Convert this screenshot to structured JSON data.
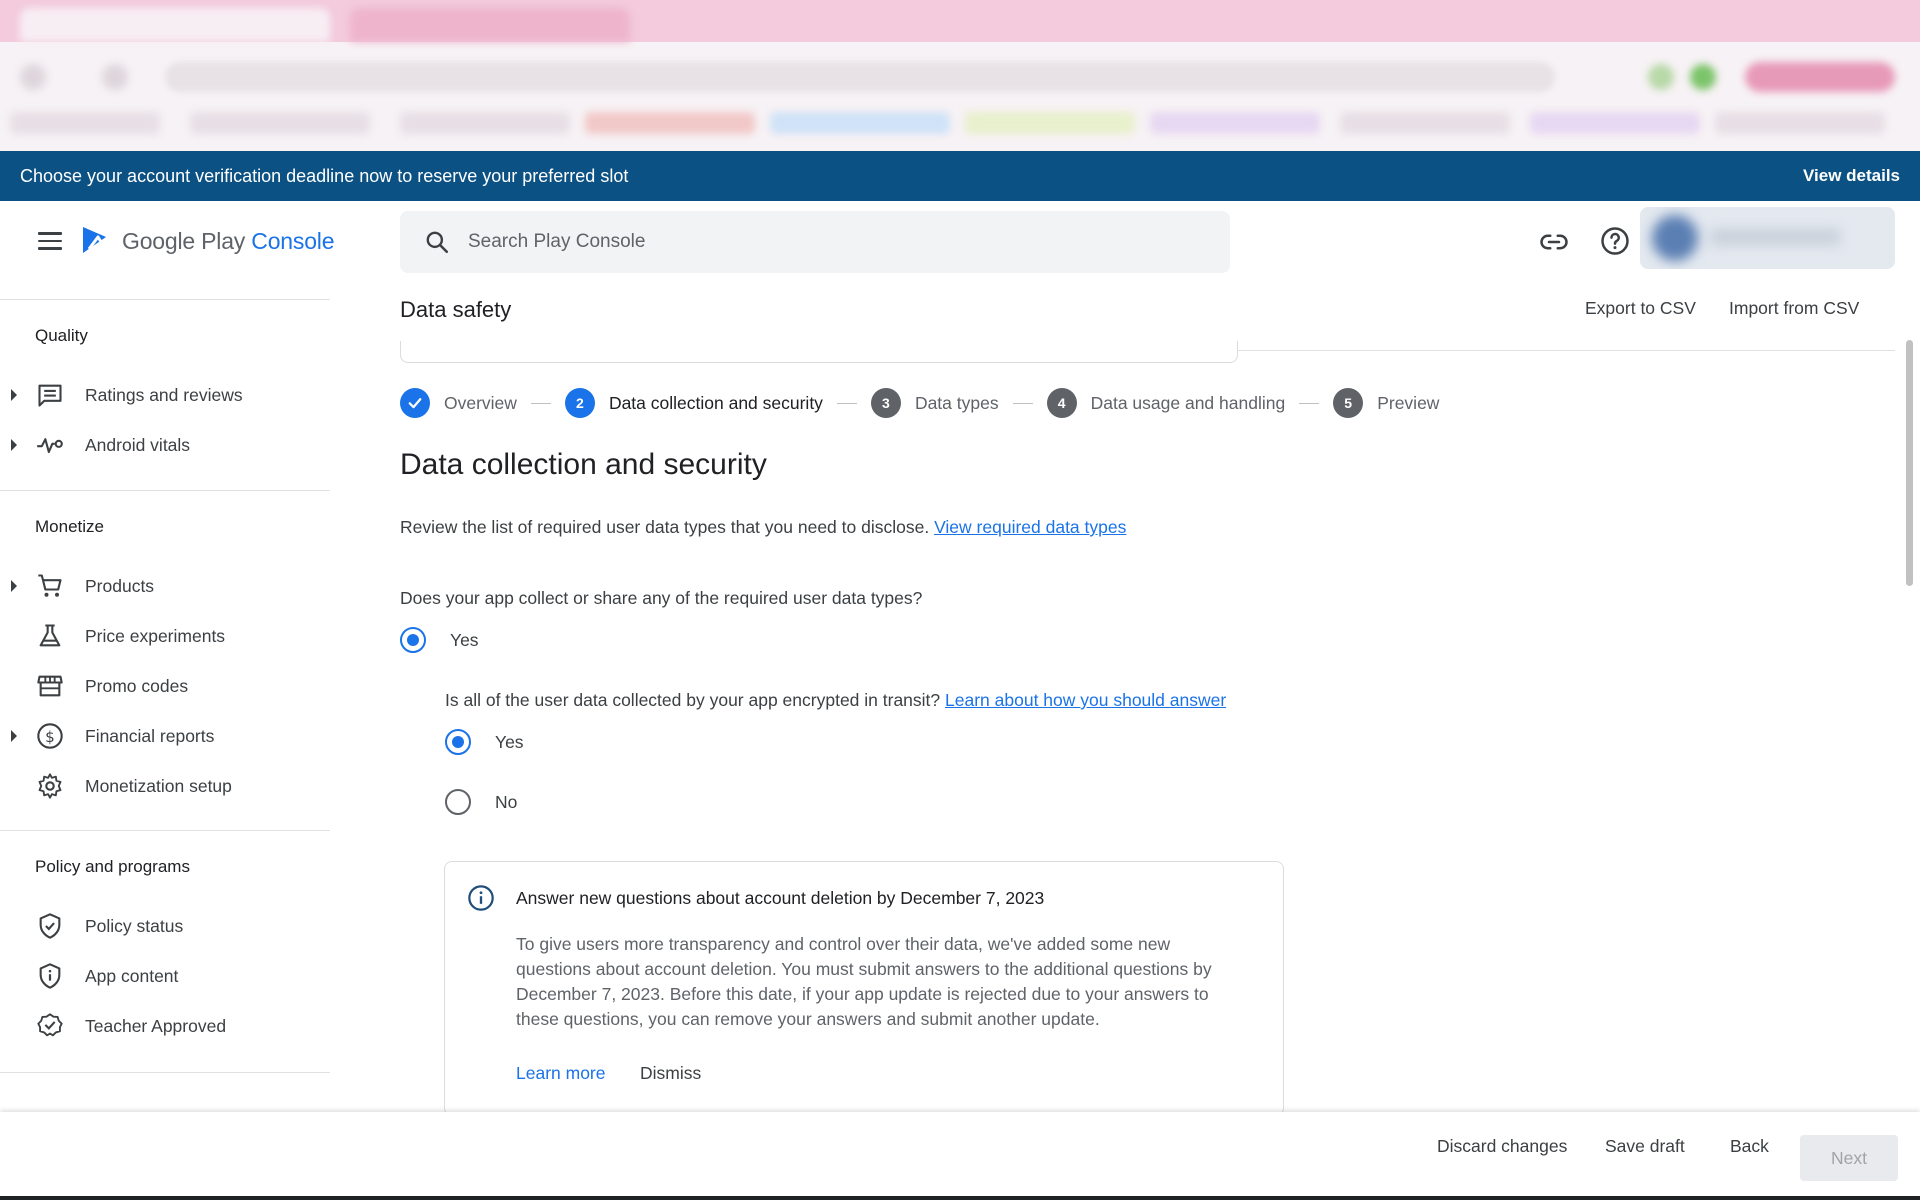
{
  "banner": {
    "text": "Choose your account verification deadline now to reserve your preferred slot",
    "action": "View details"
  },
  "header": {
    "logo_text_main": "Google Play ",
    "logo_text_accent": "Console",
    "search_placeholder": "Search Play Console",
    "icons": [
      "menu-icon",
      "search-icon",
      "link-icon",
      "help-icon"
    ]
  },
  "sidebar": {
    "sections": [
      {
        "title": "Quality",
        "items": [
          {
            "label": "Ratings and reviews",
            "icon": "reviews-icon",
            "expandable": true
          },
          {
            "label": "Android vitals",
            "icon": "vitals-icon",
            "expandable": true
          }
        ]
      },
      {
        "title": "Monetize",
        "items": [
          {
            "label": "Products",
            "icon": "cart-icon",
            "expandable": true
          },
          {
            "label": "Price experiments",
            "icon": "flask-icon",
            "expandable": false
          },
          {
            "label": "Promo codes",
            "icon": "store-icon",
            "expandable": false
          },
          {
            "label": "Financial reports",
            "icon": "dollar-icon",
            "expandable": true
          },
          {
            "label": "Monetization setup",
            "icon": "gear-icon",
            "expandable": false
          }
        ]
      },
      {
        "title": "Policy and programs",
        "items": [
          {
            "label": "Policy status",
            "icon": "shield-check-icon",
            "expandable": false
          },
          {
            "label": "App content",
            "icon": "shield-info-icon",
            "expandable": false
          },
          {
            "label": "Teacher Approved",
            "icon": "badge-icon",
            "expandable": false
          }
        ]
      }
    ]
  },
  "main": {
    "title": "Data safety",
    "export_label": "Export to CSV",
    "import_label": "Import from CSV",
    "steps": [
      {
        "number": "",
        "label": "Overview",
        "state": "done"
      },
      {
        "number": "2",
        "label": "Data collection and security",
        "state": "current"
      },
      {
        "number": "3",
        "label": "Data types",
        "state": "todo"
      },
      {
        "number": "4",
        "label": "Data usage and handling",
        "state": "todo"
      },
      {
        "number": "5",
        "label": "Preview",
        "state": "todo"
      }
    ],
    "heading": "Data collection and security",
    "intro_text": "Review the list of required user data types that you need to disclose. ",
    "intro_link": "View required data types",
    "question1": "Does your app collect or share any of the required user data types?",
    "q1_options": [
      {
        "label": "Yes",
        "checked": true
      }
    ],
    "question2_text": "Is all of the user data collected by your app encrypted in transit? ",
    "question2_link": "Learn about how you should answer",
    "q2_options": [
      {
        "label": "Yes",
        "checked": true
      },
      {
        "label": "No",
        "checked": false
      }
    ],
    "info_card": {
      "title": "Answer new questions about account deletion by December 7, 2023",
      "body": "To give users more transparency and control over their data, we've added some new questions about account deletion. You must submit answers to the additional questions by December 7, 2023. Before this date, if your app update is rejected due to your answers to these questions, you can remove your answers and submit another update.",
      "learn_more": "Learn more",
      "dismiss": "Dismiss"
    }
  },
  "footer": {
    "discard": "Discard changes",
    "save_draft": "Save draft",
    "back": "Back",
    "next": "Next"
  },
  "colors": {
    "banner_bg": "#0b5184",
    "accent": "#1a73e8",
    "step_todo": "#5f6368"
  }
}
